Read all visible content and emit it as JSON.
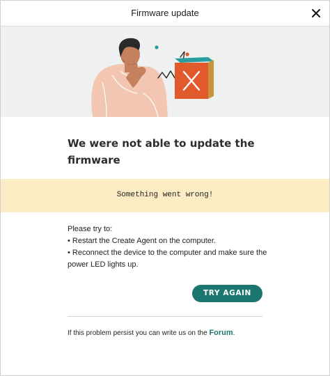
{
  "header": {
    "title": "Firmware update",
    "close_icon": "close-icon"
  },
  "illustration": {
    "icon": "confused-person-broken-box-illustration",
    "accent": "#e05a2b"
  },
  "heading": "We were not able to update the firmware",
  "error_banner": {
    "text": "Something went wrong!",
    "background": "#fbecc4"
  },
  "tips": {
    "intro": "Please try to:",
    "items": [
      "• Restart the Create Agent on the computer.",
      "• Reconnect the device to the computer and make sure the power LED lights up."
    ]
  },
  "actions": {
    "try_again_label": "TRY AGAIN",
    "accent": "#1c7670"
  },
  "footer": {
    "text": "If this problem persist you can write us on the ",
    "link_label": "Forum",
    "suffix": "."
  }
}
